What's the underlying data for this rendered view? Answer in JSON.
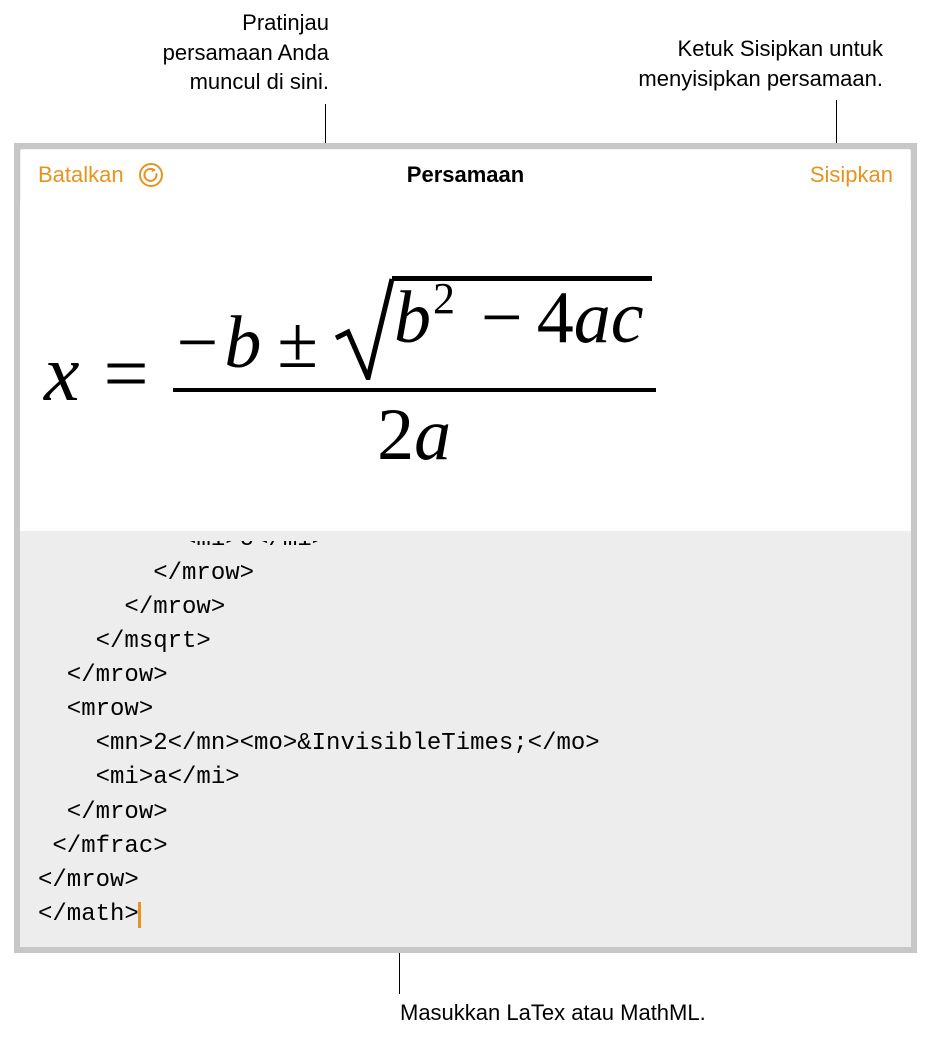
{
  "callouts": {
    "preview": "Pratinjau\npersamaan Anda\nmuncul di sini.",
    "insert_hint": "Ketuk Sisipkan untuk\nmenyisipkan persamaan.",
    "input_hint": "Masukkan LaTex atau MathML."
  },
  "toolbar": {
    "cancel_label": "Batalkan",
    "title": "Persamaan",
    "insert_label": "Sisipkan",
    "undo_icon_name": "undo-icon"
  },
  "equation_preview": {
    "lhs_var": "x",
    "op_eq": "=",
    "num_minus": "−",
    "num_b": "b",
    "num_pm": "±",
    "rad_b": "b",
    "rad_exp": "2",
    "rad_minus": "−",
    "rad_4": "4",
    "rad_a": "a",
    "rad_c": "c",
    "den_2": "2",
    "den_a": "a"
  },
  "code": {
    "partial_top": "          <mi>c</mi>",
    "lines": [
      "        </mrow>",
      "      </mrow>",
      "    </msqrt>",
      "  </mrow>",
      "  <mrow>",
      "    <mn>2</mn><mo>&InvisibleTimes;</mo>",
      "    <mi>a</mi>",
      "  </mrow>",
      " </mfrac>",
      "</mrow>",
      "</math>"
    ]
  },
  "colors": {
    "accent": "#e5941f"
  }
}
